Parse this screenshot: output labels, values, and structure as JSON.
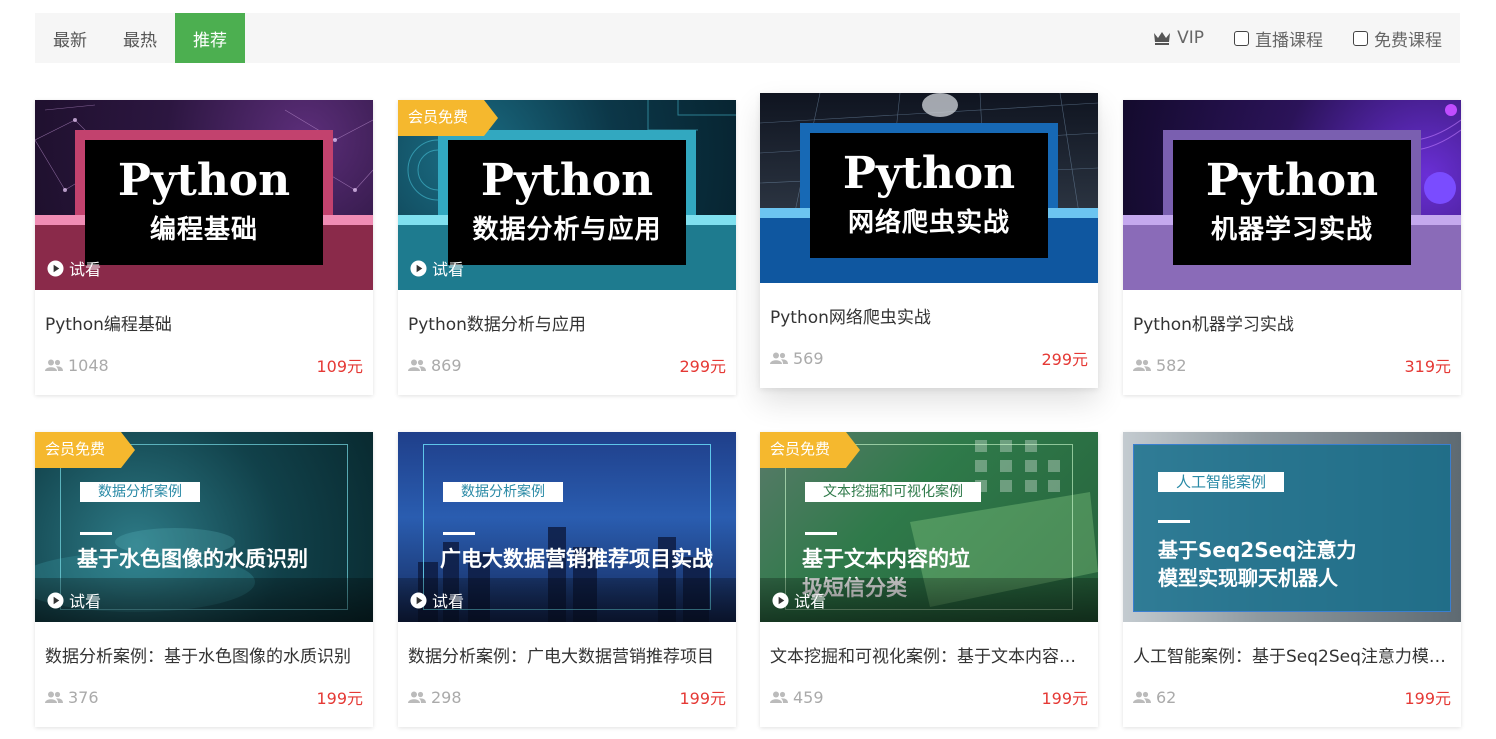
{
  "tabs": [
    {
      "label": "最新"
    },
    {
      "label": "最热"
    },
    {
      "label": "推荐"
    }
  ],
  "active_tab": "推荐",
  "filters": {
    "vip_label": "VIP",
    "live_label": "直播课程",
    "free_label": "免费课程"
  },
  "colors": {
    "accent": "#4caf50",
    "price": "#e53935",
    "vip_badge": "#f5b82e"
  },
  "trial_label": "试看",
  "vip_free_label": "会员免费",
  "courses": [
    {
      "cover_title": "Python",
      "cover_subtitle": "编程基础",
      "title": "Python编程基础",
      "students": "1048",
      "price": "109元"
    },
    {
      "cover_title": "Python",
      "cover_subtitle": "数据分析与应用",
      "title": "Python数据分析与应用",
      "students": "869",
      "price": "299元"
    },
    {
      "cover_title": "Python",
      "cover_subtitle": "网络爬虫实战",
      "title": "Python网络爬虫实战",
      "students": "569",
      "price": "299元"
    },
    {
      "cover_title": "Python",
      "cover_subtitle": "机器学习实战",
      "title": "Python机器学习实战",
      "students": "582",
      "price": "319元"
    },
    {
      "cover_tag": "数据分析案例",
      "cover_title": "基于水色图像的水质识别",
      "title": "数据分析案例：基于水色图像的水质识别",
      "students": "376",
      "price": "199元"
    },
    {
      "cover_tag": "数据分析案例",
      "cover_title": "广电大数据营销推荐项目实战",
      "title": "数据分析案例：广电大数据营销推荐项目",
      "students": "298",
      "price": "199元"
    },
    {
      "cover_tag": "文本挖掘和可视化案例",
      "cover_title": "基于文本内容的垃圾短信分类",
      "title": "文本挖掘和可视化案例：基于文本内容…",
      "students": "459",
      "price": "199元"
    },
    {
      "cover_tag": "人工智能案例",
      "cover_title": "基于Seq2Seq注意力模型实现聊天机器人",
      "title": "人工智能案例：基于Seq2Seq注意力模…",
      "students": "62",
      "price": "199元"
    }
  ]
}
